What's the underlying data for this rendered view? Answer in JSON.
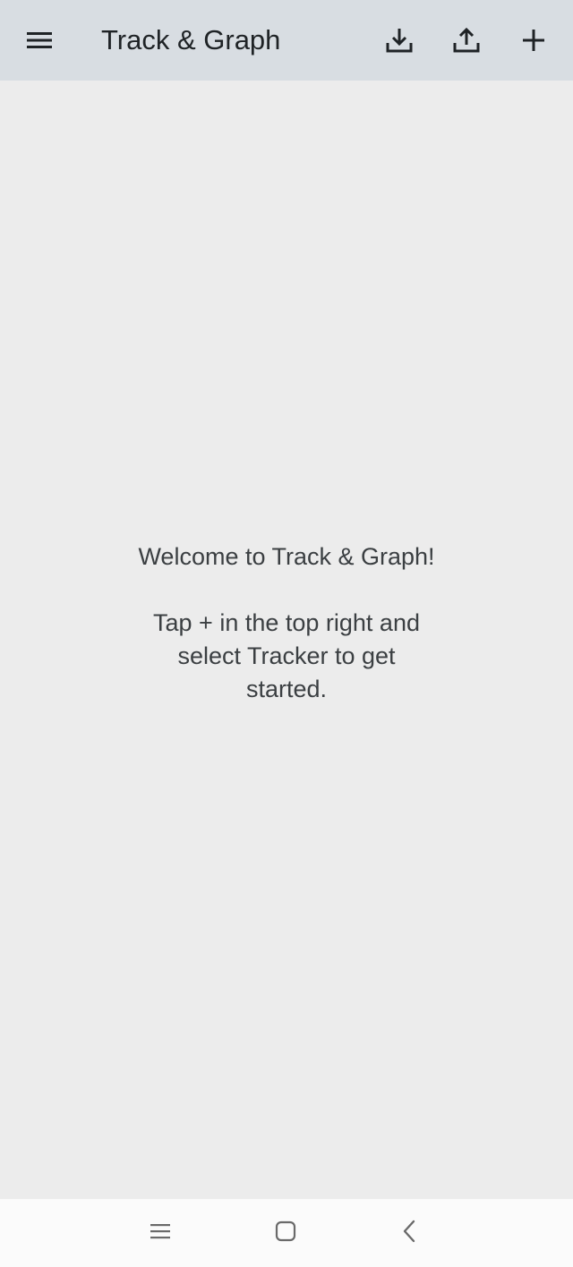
{
  "app_bar": {
    "title": "Track & Graph",
    "menu_icon": "hamburger-menu-icon",
    "actions": [
      {
        "name": "import",
        "icon": "download-icon"
      },
      {
        "name": "export",
        "icon": "upload-icon"
      },
      {
        "name": "add",
        "icon": "plus-icon"
      }
    ],
    "background": "#d8dde2"
  },
  "main": {
    "empty_message": "Welcome to Track & Graph!\n\nTap + in the top right and select Tracker to get started.",
    "background": "#ececec"
  },
  "system_nav": {
    "items": [
      {
        "name": "recents",
        "icon": "recents-icon"
      },
      {
        "name": "home",
        "icon": "home-icon"
      },
      {
        "name": "back",
        "icon": "back-icon"
      }
    ]
  }
}
